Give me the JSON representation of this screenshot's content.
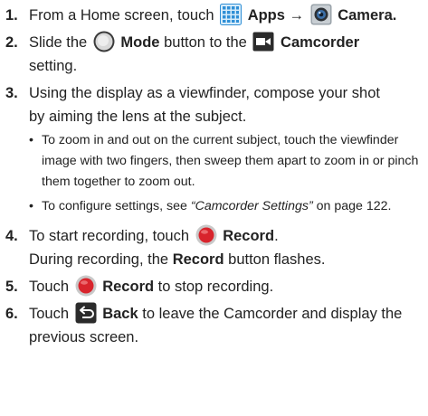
{
  "steps": [
    {
      "num": "1.",
      "parts": {
        "a": "From a Home screen, touch",
        "apps": "Apps",
        "arrow": "→",
        "camera": "Camera."
      }
    },
    {
      "num": "2.",
      "parts": {
        "a": "Slide the",
        "mode": "Mode",
        "b": "button to the",
        "camcorder": "Camcorder",
        "c": "setting."
      }
    },
    {
      "num": "3.",
      "text_line1": "Using the display as a viewfinder, compose your shot",
      "text_line2": "by aiming the lens at the subject.",
      "bullets": [
        {
          "symbol": "•",
          "text": "To zoom in and out on the current subject, touch the viewfinder image with two fingers, then sweep them apart to zoom in or pinch them together to zoom out."
        },
        {
          "symbol": "•",
          "pre": "To configure settings, see",
          "link": "“Camcorder Settings”",
          "post": "on page 122."
        }
      ]
    },
    {
      "num": "4.",
      "parts": {
        "a": "To start recording, touch",
        "record": "Record",
        "b": ".",
        "line2a": "During recording, the",
        "line2b": "Record",
        "line2c": "button flashes."
      }
    },
    {
      "num": "5.",
      "parts": {
        "a": "Touch",
        "record": "Record",
        "b": "to stop recording."
      }
    },
    {
      "num": "6.",
      "parts": {
        "a": "Touch",
        "back": "Back",
        "b": "to leave the Camcorder and display the previous screen."
      }
    }
  ],
  "icons": {
    "apps": "apps-grid-icon",
    "camera": "camera-icon",
    "mode": "mode-toggle-icon",
    "camcorder": "camcorder-icon",
    "record": "record-button-icon",
    "back": "back-arrow-icon"
  },
  "colors": {
    "text": "#222222",
    "apps_blue": "#2f8fd6",
    "record_red": "#d8242c",
    "dark_icon": "#2b2b2b"
  }
}
